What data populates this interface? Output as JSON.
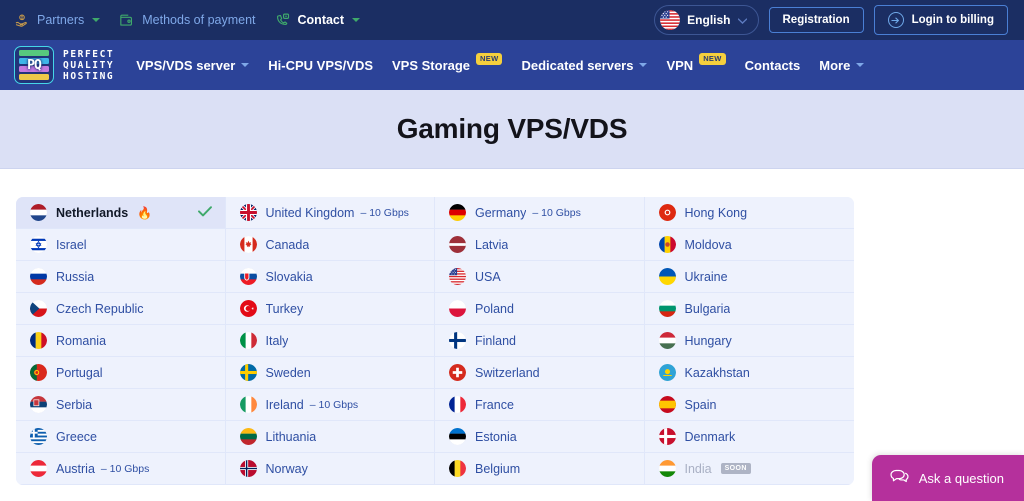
{
  "topbar": {
    "items": [
      {
        "label": "Partners",
        "icon": "hand-coin-icon",
        "caret": true,
        "strong": false
      },
      {
        "label": "Methods of payment",
        "icon": "wallet-icon",
        "caret": false,
        "strong": false
      },
      {
        "label": "Contact",
        "icon": "phone-chat-icon",
        "caret": true,
        "strong": true
      }
    ],
    "language": {
      "label": "English",
      "flag": "us-flag-icon"
    },
    "registration_label": "Registration",
    "login_label": "Login to billing"
  },
  "brand": {
    "line1": "PERFECT",
    "line2": "QUALITY",
    "line3": "HOSTING",
    "mark": "PQ"
  },
  "nav": {
    "items": [
      {
        "label": "VPS/VDS server",
        "caret": true,
        "badge": ""
      },
      {
        "label": "Hi-CPU VPS/VDS",
        "caret": false,
        "badge": ""
      },
      {
        "label": "VPS Storage",
        "caret": false,
        "badge": "NEW"
      },
      {
        "label": "Dedicated servers",
        "caret": true,
        "badge": ""
      },
      {
        "label": "VPN",
        "caret": false,
        "badge": "NEW"
      },
      {
        "label": "Contacts",
        "caret": false,
        "badge": ""
      },
      {
        "label": "More",
        "caret": true,
        "badge": ""
      }
    ]
  },
  "hero": {
    "title": "Gaming VPS/VDS"
  },
  "colors": {
    "topbar_bg": "#1b2e63",
    "nav_bg": "#2c4398",
    "hero_bg": "#dbe0f5",
    "cell_bg": "#eef2fd",
    "cell_active_bg": "#dfe4f8",
    "link": "#2f4fa3",
    "badge_new": "#f5cf3d",
    "chat": "#b5309c",
    "check": "#3fa96b"
  },
  "countries": [
    {
      "name": "Netherlands",
      "flag": "nl",
      "speed": "",
      "active": true,
      "hot": true,
      "check": true,
      "soon": false
    },
    {
      "name": "United Kingdom",
      "flag": "gb",
      "speed": "10 Gbps",
      "active": false,
      "hot": false,
      "check": false,
      "soon": false
    },
    {
      "name": "Germany",
      "flag": "de",
      "speed": "10 Gbps",
      "active": false,
      "hot": false,
      "check": false,
      "soon": false
    },
    {
      "name": "Hong Kong",
      "flag": "hk",
      "speed": "",
      "active": false,
      "hot": false,
      "check": false,
      "soon": false
    },
    {
      "name": "Israel",
      "flag": "il",
      "speed": "",
      "active": false,
      "hot": false,
      "check": false,
      "soon": false
    },
    {
      "name": "Canada",
      "flag": "ca",
      "speed": "",
      "active": false,
      "hot": false,
      "check": false,
      "soon": false
    },
    {
      "name": "Latvia",
      "flag": "lv",
      "speed": "",
      "active": false,
      "hot": false,
      "check": false,
      "soon": false
    },
    {
      "name": "Moldova",
      "flag": "md",
      "speed": "",
      "active": false,
      "hot": false,
      "check": false,
      "soon": false
    },
    {
      "name": "Russia",
      "flag": "ru",
      "speed": "",
      "active": false,
      "hot": false,
      "check": false,
      "soon": false
    },
    {
      "name": "Slovakia",
      "flag": "sk",
      "speed": "",
      "active": false,
      "hot": false,
      "check": false,
      "soon": false
    },
    {
      "name": "USA",
      "flag": "us",
      "speed": "",
      "active": false,
      "hot": false,
      "check": false,
      "soon": false
    },
    {
      "name": "Ukraine",
      "flag": "ua",
      "speed": "",
      "active": false,
      "hot": false,
      "check": false,
      "soon": false
    },
    {
      "name": "Czech Republic",
      "flag": "cz",
      "speed": "",
      "active": false,
      "hot": false,
      "check": false,
      "soon": false
    },
    {
      "name": "Turkey",
      "flag": "tr",
      "speed": "",
      "active": false,
      "hot": false,
      "check": false,
      "soon": false
    },
    {
      "name": "Poland",
      "flag": "pl",
      "speed": "",
      "active": false,
      "hot": false,
      "check": false,
      "soon": false
    },
    {
      "name": "Bulgaria",
      "flag": "bg",
      "speed": "",
      "active": false,
      "hot": false,
      "check": false,
      "soon": false
    },
    {
      "name": "Romania",
      "flag": "ro",
      "speed": "",
      "active": false,
      "hot": false,
      "check": false,
      "soon": false
    },
    {
      "name": "Italy",
      "flag": "it",
      "speed": "",
      "active": false,
      "hot": false,
      "check": false,
      "soon": false
    },
    {
      "name": "Finland",
      "flag": "fi",
      "speed": "",
      "active": false,
      "hot": false,
      "check": false,
      "soon": false
    },
    {
      "name": "Hungary",
      "flag": "hu",
      "speed": "",
      "active": false,
      "hot": false,
      "check": false,
      "soon": false
    },
    {
      "name": "Portugal",
      "flag": "pt",
      "speed": "",
      "active": false,
      "hot": false,
      "check": false,
      "soon": false
    },
    {
      "name": "Sweden",
      "flag": "se",
      "speed": "",
      "active": false,
      "hot": false,
      "check": false,
      "soon": false
    },
    {
      "name": "Switzerland",
      "flag": "ch",
      "speed": "",
      "active": false,
      "hot": false,
      "check": false,
      "soon": false
    },
    {
      "name": "Kazakhstan",
      "flag": "kz",
      "speed": "",
      "active": false,
      "hot": false,
      "check": false,
      "soon": false
    },
    {
      "name": "Serbia",
      "flag": "rs",
      "speed": "",
      "active": false,
      "hot": false,
      "check": false,
      "soon": false
    },
    {
      "name": "Ireland",
      "flag": "ie",
      "speed": "10 Gbps",
      "active": false,
      "hot": false,
      "check": false,
      "soon": false
    },
    {
      "name": "France",
      "flag": "fr",
      "speed": "",
      "active": false,
      "hot": false,
      "check": false,
      "soon": false
    },
    {
      "name": "Spain",
      "flag": "es",
      "speed": "",
      "active": false,
      "hot": false,
      "check": false,
      "soon": false
    },
    {
      "name": "Greece",
      "flag": "gr",
      "speed": "",
      "active": false,
      "hot": false,
      "check": false,
      "soon": false
    },
    {
      "name": "Lithuania",
      "flag": "lt",
      "speed": "",
      "active": false,
      "hot": false,
      "check": false,
      "soon": false
    },
    {
      "name": "Estonia",
      "flag": "ee",
      "speed": "",
      "active": false,
      "hot": false,
      "check": false,
      "soon": false
    },
    {
      "name": "Denmark",
      "flag": "dk",
      "speed": "",
      "active": false,
      "hot": false,
      "check": false,
      "soon": false
    },
    {
      "name": "Austria",
      "flag": "at",
      "speed": "10 Gbps",
      "active": false,
      "hot": false,
      "check": false,
      "soon": false
    },
    {
      "name": "Norway",
      "flag": "no",
      "speed": "",
      "active": false,
      "hot": false,
      "check": false,
      "soon": false
    },
    {
      "name": "Belgium",
      "flag": "be",
      "speed": "",
      "active": false,
      "hot": false,
      "check": false,
      "soon": false
    },
    {
      "name": "India",
      "flag": "in",
      "speed": "",
      "active": false,
      "hot": false,
      "check": false,
      "soon": true,
      "soon_label": "SOON"
    }
  ],
  "chat": {
    "label": "Ask a question",
    "icon": "chat-bubble-icon"
  },
  "labels": {
    "speed_separator": "–",
    "soon": "SOON"
  }
}
